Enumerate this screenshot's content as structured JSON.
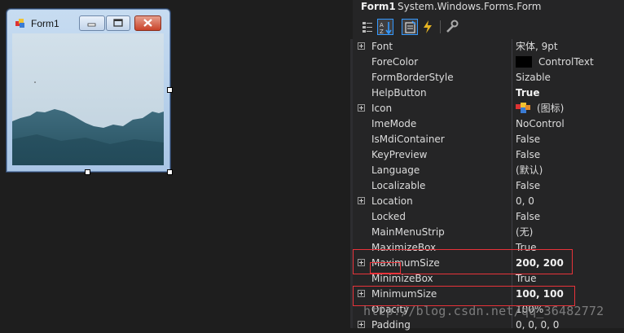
{
  "form": {
    "title": "Form1",
    "min_glyph": "minimize-icon",
    "max_glyph": "maximize-icon",
    "close_glyph": "close-icon"
  },
  "property_grid": {
    "object_name": "Form1",
    "object_type": "System.Windows.Forms.Form",
    "toolbar": [
      "categorized-icon",
      "alphabetical-icon",
      "properties-icon",
      "events-icon",
      "property-pages-icon"
    ],
    "properties": [
      {
        "name": "Font",
        "value": "宋体, 9pt",
        "expandable": true,
        "bold": false
      },
      {
        "name": "ForeColor",
        "value": "ControlText",
        "swatch": "#000000",
        "expandable": false,
        "bold": false
      },
      {
        "name": "FormBorderStyle",
        "value": "Sizable",
        "expandable": false,
        "bold": false
      },
      {
        "name": "HelpButton",
        "value": "True",
        "expandable": false,
        "bold": true
      },
      {
        "name": "Icon",
        "value": "(图标)",
        "icon": "app-icon",
        "expandable": true,
        "bold": false
      },
      {
        "name": "ImeMode",
        "value": "NoControl",
        "expandable": false,
        "bold": false
      },
      {
        "name": "IsMdiContainer",
        "value": "False",
        "expandable": false,
        "bold": false
      },
      {
        "name": "KeyPreview",
        "value": "False",
        "expandable": false,
        "bold": false
      },
      {
        "name": "Language",
        "value": "(默认)",
        "expandable": false,
        "bold": false
      },
      {
        "name": "Localizable",
        "value": "False",
        "expandable": false,
        "bold": false
      },
      {
        "name": "Location",
        "value": "0, 0",
        "expandable": true,
        "bold": false
      },
      {
        "name": "Locked",
        "value": "False",
        "expandable": false,
        "bold": false
      },
      {
        "name": "MainMenuStrip",
        "value": "(无)",
        "expandable": false,
        "bold": false
      },
      {
        "name": "MaximizeBox",
        "value": "True",
        "expandable": false,
        "bold": false
      },
      {
        "name": "MaximumSize",
        "value": "200, 200",
        "expandable": true,
        "bold": true
      },
      {
        "name": "MinimizeBox",
        "value": "True",
        "expandable": false,
        "bold": false
      },
      {
        "name": "MinimumSize",
        "value": "100, 100",
        "expandable": true,
        "bold": true
      },
      {
        "name": "Opacity",
        "value": "100%",
        "expandable": false,
        "bold": false
      },
      {
        "name": "Padding",
        "value": "0, 0, 0, 0",
        "expandable": true,
        "bold": false
      }
    ]
  },
  "watermark": "http://blog.csdn.net/qq_36482772",
  "colors": {
    "highlight": "#e8333a",
    "panel": "#252526",
    "designer": "#1e1e1e"
  }
}
